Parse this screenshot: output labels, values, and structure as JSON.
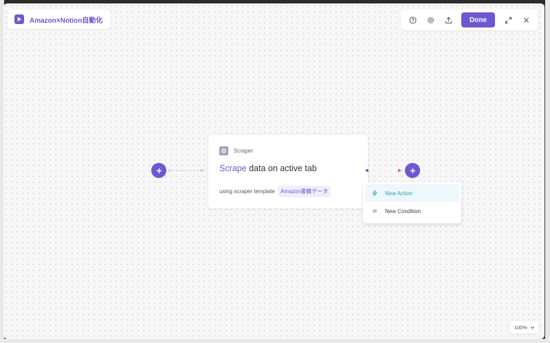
{
  "header": {
    "title": "Amazon×Notion自動化",
    "done_label": "Done",
    "icons": [
      "help-icon",
      "gear-icon",
      "upload-icon",
      "expand-icon",
      "close-icon"
    ]
  },
  "node": {
    "type_label": "Scraper",
    "title_verb": "Scrape",
    "title_rest": "data on active tab",
    "sub_prefix": "using scraper template",
    "template_name": "Amazon書籍データ"
  },
  "add_menu": {
    "items": [
      {
        "label": "New Action",
        "icon": "bolt-icon",
        "active": true
      },
      {
        "label": "New Condition",
        "icon": "equals-icon",
        "active": false
      }
    ]
  },
  "zoom": {
    "label": "100%"
  },
  "colors": {
    "accent": "#6e57d2",
    "menu_active": "#2a9fb8",
    "connector_end": "#f06b6b"
  }
}
